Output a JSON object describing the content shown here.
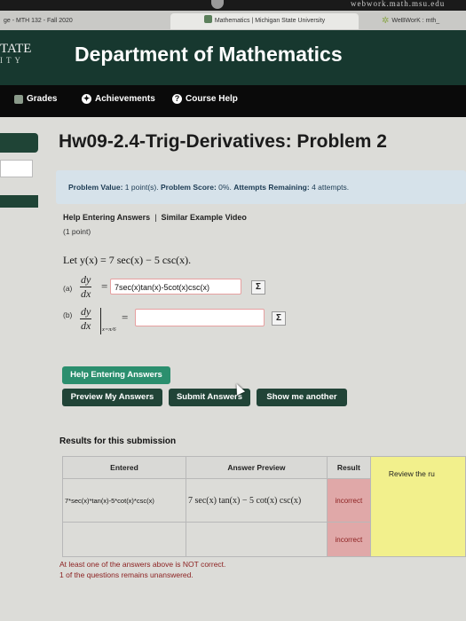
{
  "browser": {
    "url_fragment": "webwork.math.msu.edu",
    "tabs": [
      {
        "label": "ge - MTH 132 - Fall 2020"
      },
      {
        "label": "Mathematics | Michigan State University"
      },
      {
        "label": "WeBWorK : mth_"
      }
    ]
  },
  "header": {
    "logo_top": "TATE",
    "logo_bottom": "ITY",
    "department": "Department of Mathematics"
  },
  "nav": {
    "items": [
      {
        "label": "Grades",
        "icon": "grades-icon"
      },
      {
        "label": "Achievements",
        "icon": "achievements-icon"
      },
      {
        "label": "Course Help",
        "icon": "help-icon"
      }
    ]
  },
  "problem": {
    "title": "Hw09-2.4-Trig-Derivatives: Problem 2",
    "value_label": "Problem Value:",
    "value": "1 point(s).",
    "score_label": "Problem Score:",
    "score": "0%.",
    "attempts_label": "Attempts Remaining:",
    "attempts": "4 attempts.",
    "help_link": "Help Entering Answers",
    "video_link": "Similar Example Video",
    "points": "(1 point)",
    "statement": "Let y(x) = 7 sec(x) − 5 csc(x).",
    "part_a_label": "(a)",
    "part_a_num": "dy",
    "part_a_den": "dx",
    "part_a_answer": "7sec(x)tan(x)-5cot(x)csc(x)",
    "part_b_label": "(b)",
    "part_b_num": "dy",
    "part_b_den": "dx",
    "part_b_eval": "x=π/6",
    "part_b_answer": "",
    "equals": "=",
    "sigma": "Σ"
  },
  "buttons": {
    "help": "Help Entering Answers",
    "preview": "Preview My Answers",
    "submit": "Submit Answers",
    "another": "Show me another"
  },
  "results": {
    "heading": "Results for this submission",
    "columns": [
      "Entered",
      "Answer Preview",
      "Result"
    ],
    "rows": [
      {
        "entered": "7*sec(x)*tan(x)-5*cot(x)*csc(x)",
        "preview": "7 sec(x) tan(x) − 5 cot(x) csc(x)",
        "result": "incorrect"
      },
      {
        "entered": "",
        "preview": "",
        "result": "incorrect"
      }
    ],
    "review_label": "Review the ru",
    "warning1": "At least one of the answers above is NOT correct.",
    "warning2": "1 of the questions remains unanswered."
  },
  "colors": {
    "header_green": "#17382f",
    "button_green": "#214437",
    "help_green": "#2b8f6e",
    "incorrect_red": "#e0a8a8",
    "review_yellow": "#f2f08c"
  }
}
